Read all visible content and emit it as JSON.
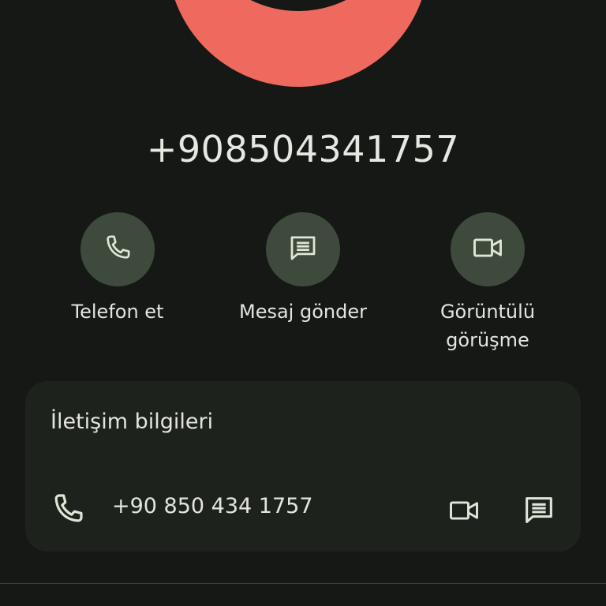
{
  "contact": {
    "title_number": "+908504341757"
  },
  "actions": [
    {
      "label": "Telefon et",
      "icon": "phone-icon"
    },
    {
      "label": "Mesaj gönder",
      "icon": "message-icon"
    },
    {
      "label_line1": "Görüntülü",
      "label_line2": "görüşme",
      "icon": "video-icon"
    }
  ],
  "info_card": {
    "title": "İletişim bilgileri",
    "phone": "+90 850 434 1757",
    "icons": [
      "phone-icon",
      "video-icon",
      "message-icon"
    ]
  },
  "colors": {
    "background": "#151815",
    "avatar": "#ee6a5f",
    "action_circle": "#3e4a3c",
    "card": "#1e221d",
    "text": "#e3e6df"
  }
}
